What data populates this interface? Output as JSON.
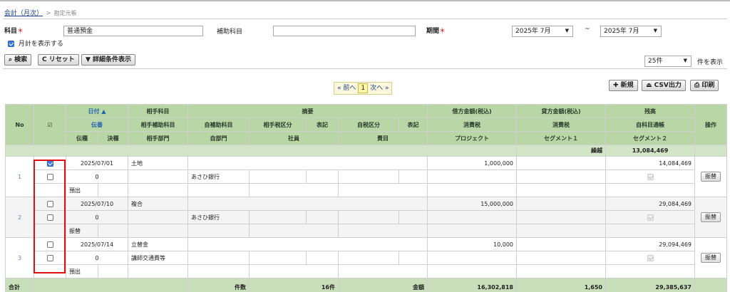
{
  "breadcrumb": {
    "link": "会計（月次）",
    "sep": ">",
    "current": "勘定元帳"
  },
  "filters": {
    "account_label": "科目",
    "required_mark": "＊",
    "account_value": "普通預金",
    "sub_account_label": "補助科目",
    "sub_account_value": "",
    "period_label": "期間",
    "period_from": "2025年 7月",
    "period_sep": "~",
    "period_to": "2025年 7月",
    "show_monthly_label": "月計を表示する"
  },
  "toolbar": {
    "search": "⌕ 検索",
    "reset": "C リセット",
    "detail": "▼ 詳細条件表示",
    "per_page_value": "25件",
    "per_page_suffix": "件を表示",
    "new": "✚ 新規",
    "csv": "⏏ CSV出力",
    "print": "⎙ 印刷"
  },
  "pager": {
    "prev": "« 前へ",
    "page": "1",
    "next": "次へ »"
  },
  "table": {
    "h": {
      "no": "No",
      "chk": "☑",
      "date": "日付 ▲",
      "voucher": "伝番",
      "type1": "伝種",
      "type2": "決種",
      "counter": "相手科目",
      "counter_sub": "相手補助科目",
      "counter_dept": "相手部門",
      "summary": "摘要",
      "self_sub": "自補助科目",
      "counter_tax": "相手税区分",
      "mark1": "表記",
      "self_tax": "自税区分",
      "mark2": "表記",
      "self_dept": "自部門",
      "employee": "社員",
      "item": "費目",
      "debit": "借方金額(税込)",
      "credit": "貸方金額(税込)",
      "balance": "残高",
      "tax1": "消費税",
      "tax2": "消費税",
      "self_transfer": "自科目通帳",
      "project": "プロジェクト",
      "seg1": "セグメント１",
      "seg2": "セグメント２",
      "op": "操作"
    },
    "carry_label": "繰越",
    "carry_value": "13,084,469",
    "rows": [
      {
        "no": "1",
        "date": "2025/07/01",
        "voucher": "0",
        "counter": "土地",
        "summary": "あさひ銀行",
        "type": "預出",
        "debit": "1,000,000",
        "balance": "14,084,469",
        "op": "振替"
      },
      {
        "no": "2",
        "date": "2025/07/10",
        "voucher": "0",
        "counter": "複合",
        "summary": "あさひ銀行",
        "type": "振替",
        "debit": "15,000,000",
        "balance": "29,084,469",
        "op": "振替"
      },
      {
        "no": "3",
        "date": "2025/07/14",
        "voucher": "0",
        "counter": "立替金",
        "summary": "講師交通費等",
        "type": "預出",
        "debit": "10,000",
        "balance": "29,094,469",
        "op": "振替"
      }
    ],
    "total": {
      "label": "合計",
      "count_label": "件数",
      "count": "16件",
      "amount_label": "金額",
      "debit": "16,302,818",
      "credit": "1,650",
      "balance": "29,385,637"
    }
  }
}
